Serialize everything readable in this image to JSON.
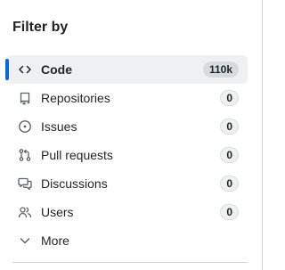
{
  "sidebar": {
    "title": "Filter by",
    "items": [
      {
        "label": "Code",
        "count": "110k",
        "icon": "code-icon"
      },
      {
        "label": "Repositories",
        "count": "0",
        "icon": "repo-icon"
      },
      {
        "label": "Issues",
        "count": "0",
        "icon": "issue-opened-icon"
      },
      {
        "label": "Pull requests",
        "count": "0",
        "icon": "git-pull-request-icon"
      },
      {
        "label": "Discussions",
        "count": "0",
        "icon": "comment-discussion-icon"
      },
      {
        "label": "Users",
        "count": "0",
        "icon": "people-icon"
      },
      {
        "label": "More",
        "icon": "chevron-down-icon"
      }
    ],
    "selected_index": 0,
    "colors": {
      "accent": "#0969da",
      "selected_bg": "#eef0f2",
      "text": "#1f2328",
      "icon": "#59636e",
      "border": "#d0d7de"
    }
  }
}
